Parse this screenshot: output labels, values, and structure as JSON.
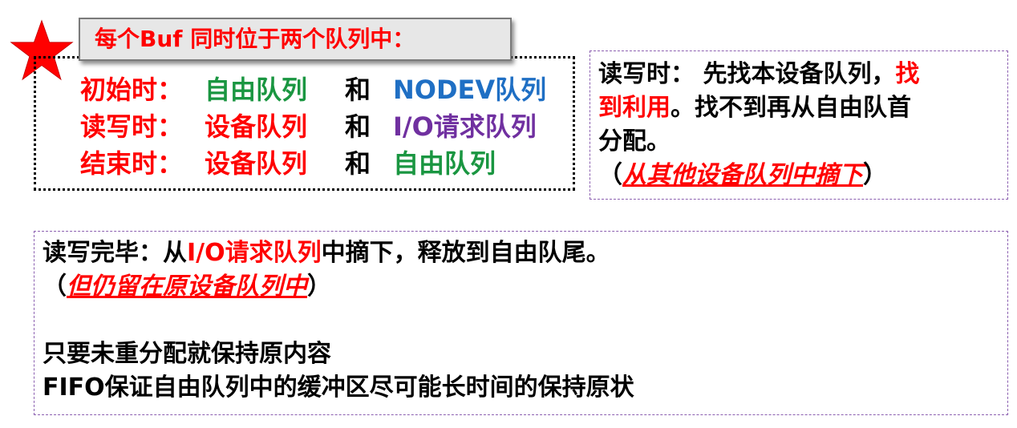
{
  "colors": {
    "red": "#ff0000",
    "green": "#1a9641",
    "blue": "#1f6fc4",
    "purple": "#7030a0",
    "star": "#ff0000"
  },
  "title": "每个Buf 同时位于两个队列中：",
  "rows": [
    {
      "label": "初始时：",
      "q1": "自由队列",
      "conj": "和",
      "q2": "NODEV队列"
    },
    {
      "label": "读写时：",
      "q1": "设备队列",
      "conj": "和",
      "q2": "I/O请求队列"
    },
    {
      "label": "结束时：",
      "q1": "设备队列",
      "conj": "和",
      "q2": "自由队列"
    }
  ],
  "right_panel": {
    "line1_a": "读写时：  先找本设备队列，",
    "line1_b": "找",
    "line2_a": "到利用",
    "line2_b": "。找不到再从自由队首",
    "line3": "分配。",
    "line4_open": " （",
    "line4_italic": "从其他设备队列中摘下",
    "line4_close": "）"
  },
  "bottom_panel": {
    "line1_a": "读写完毕：从",
    "line1_b": "I/O请求队列",
    "line1_c": "中摘下，释放到自由队尾。",
    "line2_open": " （",
    "line2_italic": "但仍留在原设备队列中",
    "line2_close": "）",
    "line3": "只要未重分配就保持原内容",
    "line4": "FIFO保证自由队列中的缓冲区尽可能长时间的保持原状"
  }
}
